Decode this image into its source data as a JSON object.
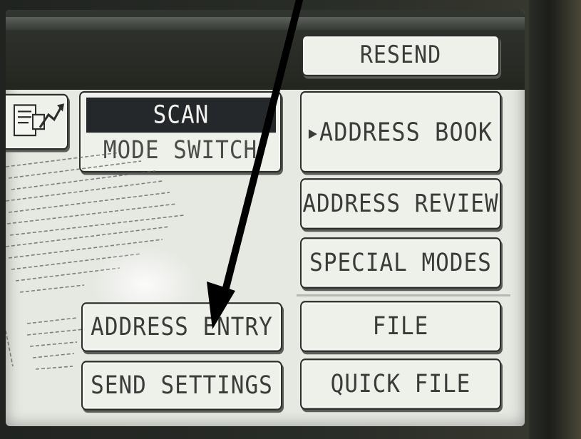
{
  "screen": {
    "resend_label": "RESEND",
    "scan_label": "SCAN",
    "mode_switch_label": "MODE SWITCH",
    "address_book_label": "ADDRESS BOOK",
    "address_review_label": "ADDRESS REVIEW",
    "special_modes_label": "SPECIAL MODES",
    "file_label": "FILE",
    "quick_file_label": "QUICK FILE",
    "address_entry_label": "ADDRESS ENTRY",
    "send_settings_label": "SEND SETTINGS"
  },
  "icons": {
    "preview_mode": "document-with-arrow-icon",
    "selected_marker": "triangle-right-icon",
    "annotation": "arrow-pointer-icon"
  },
  "colors": {
    "screen_bg": "#e6e8e2",
    "button_bg": "#eef0ea",
    "button_text": "#3a3c3a",
    "highlight_bg": "#25282a",
    "top_bar": "#23261f"
  }
}
